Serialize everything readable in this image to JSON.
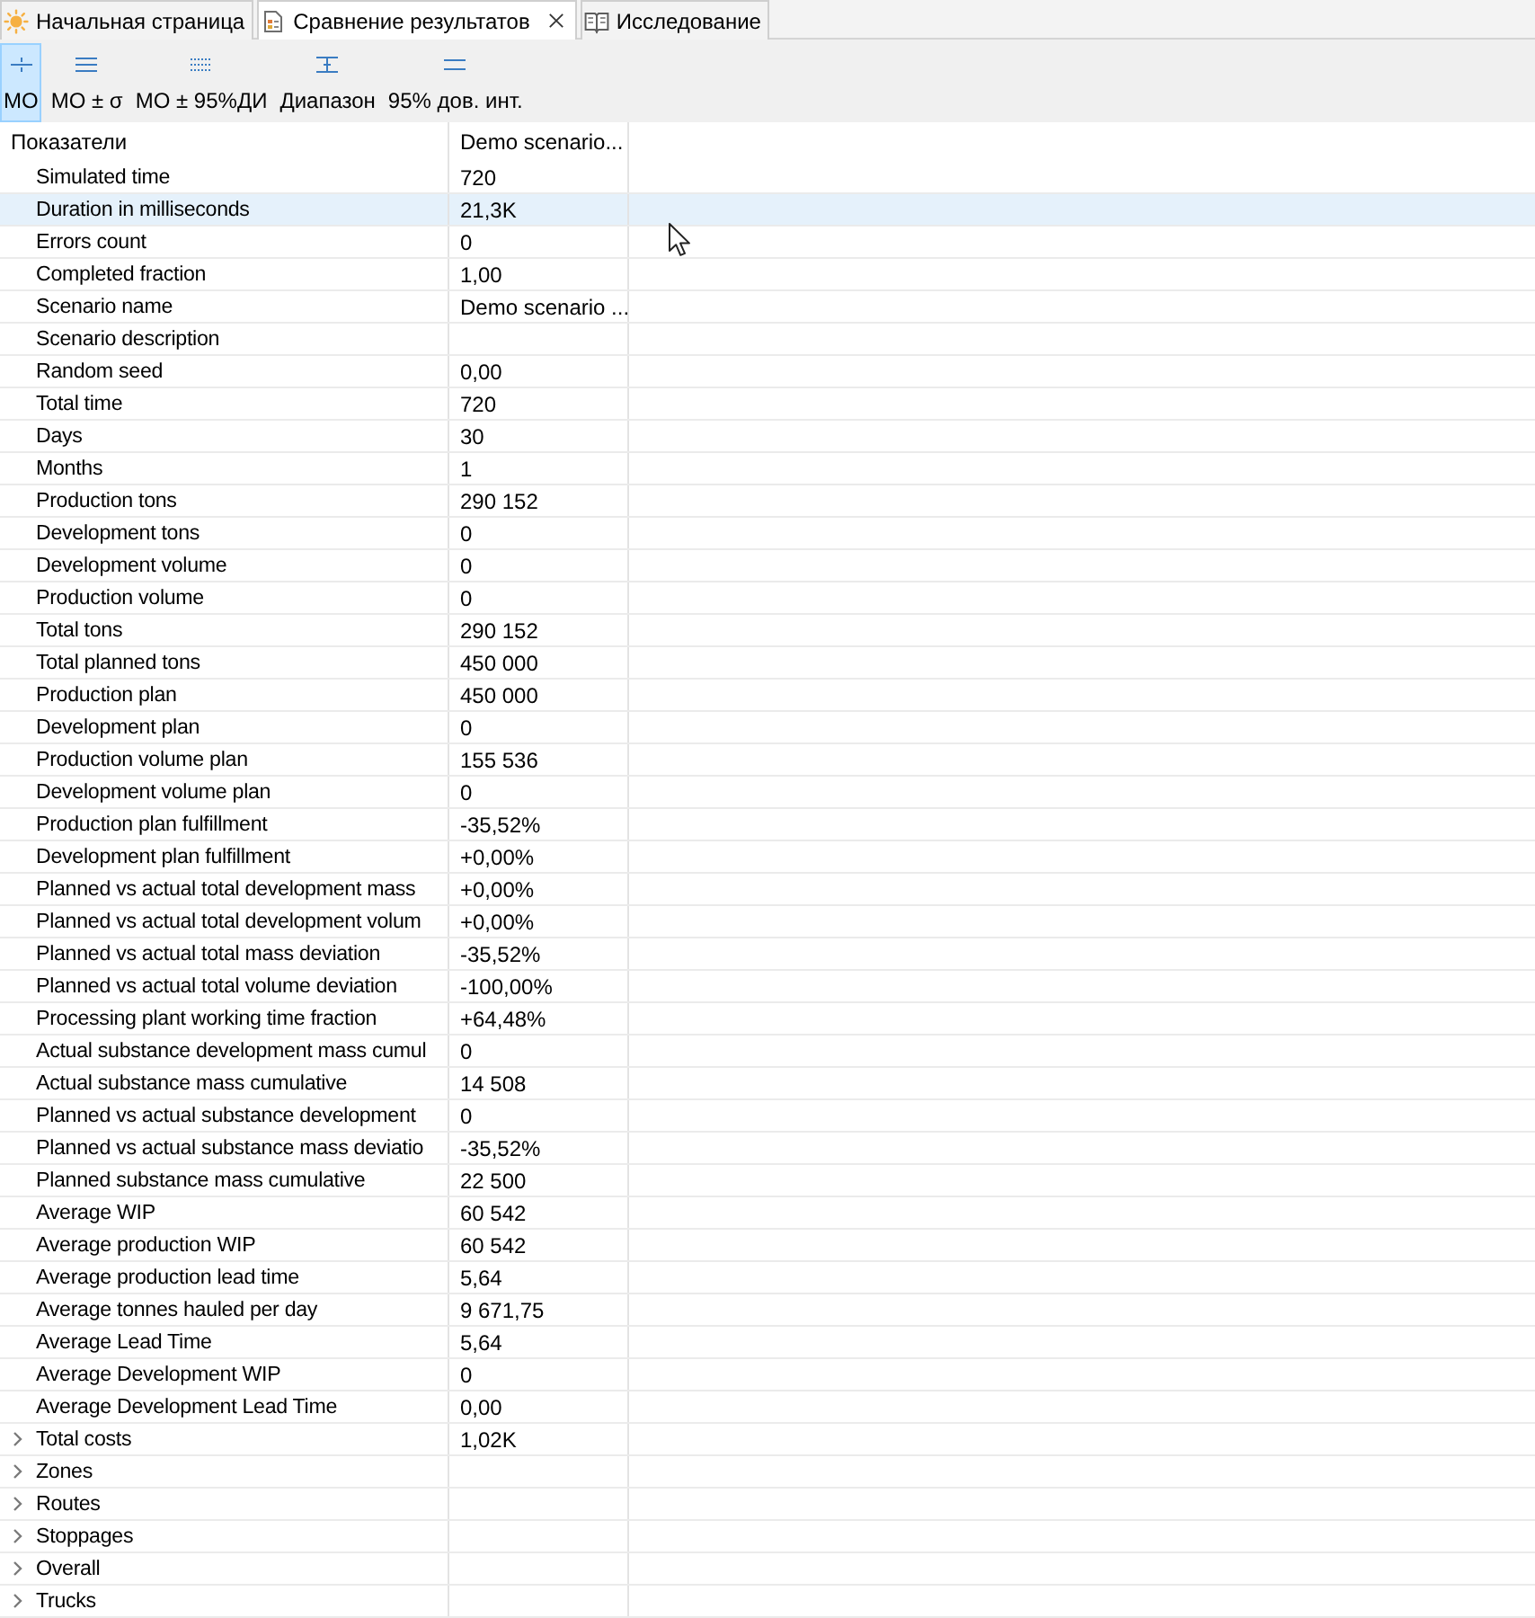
{
  "tabs": [
    {
      "label": "Начальная страница",
      "selected": false
    },
    {
      "label": "Сравнение результатов",
      "selected": true
    },
    {
      "label": "Исследование",
      "selected": false
    }
  ],
  "toolbar": [
    {
      "label": "МО",
      "selected": true
    },
    {
      "label": "МО ± σ",
      "selected": false
    },
    {
      "label": "МО ± 95%ДИ",
      "selected": false
    },
    {
      "label": "Диапазон",
      "selected": false
    },
    {
      "label": "95% дов. инт.",
      "selected": false
    }
  ],
  "table": {
    "columns": [
      "Показатели",
      "Demo scenario..."
    ],
    "rows": [
      {
        "kind": "metric",
        "label": "Simulated time",
        "value": "720",
        "selected": false
      },
      {
        "kind": "metric",
        "label": "Duration in milliseconds",
        "value": "21,3K",
        "selected": true
      },
      {
        "kind": "metric",
        "label": "Errors count",
        "value": "0",
        "selected": false
      },
      {
        "kind": "metric",
        "label": "Completed fraction",
        "value": "1,00",
        "selected": false
      },
      {
        "kind": "metric",
        "label": "Scenario name",
        "value": "Demo scenario ...",
        "selected": false
      },
      {
        "kind": "metric",
        "label": "Scenario description",
        "selected": false
      },
      {
        "kind": "metric",
        "label": "Random seed",
        "value": "0,00",
        "selected": false
      },
      {
        "kind": "metric",
        "label": "Total time",
        "value": "720",
        "selected": false
      },
      {
        "kind": "metric",
        "label": "Days",
        "value": "30",
        "selected": false
      },
      {
        "kind": "metric",
        "label": "Months",
        "value": "1",
        "selected": false
      },
      {
        "kind": "metric",
        "label": "Production tons",
        "value": "290 152",
        "selected": false
      },
      {
        "kind": "metric",
        "label": "Development tons",
        "value": "0",
        "selected": false
      },
      {
        "kind": "metric",
        "label": "Development volume",
        "value": "0",
        "selected": false
      },
      {
        "kind": "metric",
        "label": "Production volume",
        "value": "0",
        "selected": false
      },
      {
        "kind": "metric",
        "label": "Total tons",
        "value": "290 152",
        "selected": false
      },
      {
        "kind": "metric",
        "label": "Total planned tons",
        "value": "450 000",
        "selected": false
      },
      {
        "kind": "metric",
        "label": "Production plan",
        "value": "450 000",
        "selected": false
      },
      {
        "kind": "metric",
        "label": "Development plan",
        "value": "0",
        "selected": false
      },
      {
        "kind": "metric",
        "label": "Production volume plan",
        "value": "155 536",
        "selected": false
      },
      {
        "kind": "metric",
        "label": "Development volume plan",
        "value": "0",
        "selected": false
      },
      {
        "kind": "metric",
        "label": "Production plan fulfillment",
        "value": "-35,52%",
        "selected": false
      },
      {
        "kind": "metric",
        "label": "Development plan fulfillment",
        "value": "+0,00%",
        "selected": false
      },
      {
        "kind": "metric",
        "label": "Planned vs actual total development mass",
        "value": "+0,00%",
        "selected": false
      },
      {
        "kind": "metric",
        "label": "Planned vs actual total development volum",
        "value": "+0,00%",
        "selected": false
      },
      {
        "kind": "metric",
        "label": "Planned vs actual total mass deviation",
        "value": "-35,52%",
        "selected": false
      },
      {
        "kind": "metric",
        "label": "Planned vs actual total volume deviation",
        "value": "-100,00%",
        "selected": false
      },
      {
        "kind": "metric",
        "label": "Processing plant working time fraction",
        "value": "+64,48%",
        "selected": false
      },
      {
        "kind": "metric",
        "label": "Actual substance development mass cumul",
        "value": "0",
        "selected": false
      },
      {
        "kind": "metric",
        "label": "Actual substance mass cumulative",
        "value": "14 508",
        "selected": false
      },
      {
        "kind": "metric",
        "label": "Planned vs actual substance development",
        "value": "0",
        "selected": false
      },
      {
        "kind": "metric",
        "label": "Planned vs actual substance mass deviatio",
        "value": "-35,52%",
        "selected": false
      },
      {
        "kind": "metric",
        "label": "Planned substance mass cumulative",
        "value": "22 500",
        "selected": false
      },
      {
        "kind": "metric",
        "label": "Average WIP",
        "value": "60 542",
        "selected": false
      },
      {
        "kind": "metric",
        "label": "Average production WIP",
        "value": "60 542",
        "selected": false
      },
      {
        "kind": "metric",
        "label": "Average production lead time",
        "value": "5,64",
        "selected": false
      },
      {
        "kind": "metric",
        "label": "Average tonnes hauled per day",
        "value": "9 671,75",
        "selected": false
      },
      {
        "kind": "metric",
        "label": "Average Lead Time",
        "value": "5,64",
        "selected": false
      },
      {
        "kind": "metric",
        "label": "Average Development WIP",
        "value": "0",
        "selected": false
      },
      {
        "kind": "metric",
        "label": "Average Development Lead Time",
        "value": "0,00",
        "selected": false
      },
      {
        "kind": "group",
        "label": "Total costs",
        "value": "1,02K",
        "expanded": false,
        "selected": false
      },
      {
        "kind": "group",
        "label": "Zones",
        "expanded": false,
        "selected": false
      },
      {
        "kind": "group",
        "label": "Routes",
        "expanded": false,
        "selected": false
      },
      {
        "kind": "group",
        "label": "Stoppages",
        "expanded": false,
        "selected": false
      },
      {
        "kind": "group",
        "label": "Overall",
        "expanded": false,
        "selected": false
      },
      {
        "kind": "group",
        "label": "Trucks",
        "expanded": false,
        "selected": false
      }
    ]
  }
}
